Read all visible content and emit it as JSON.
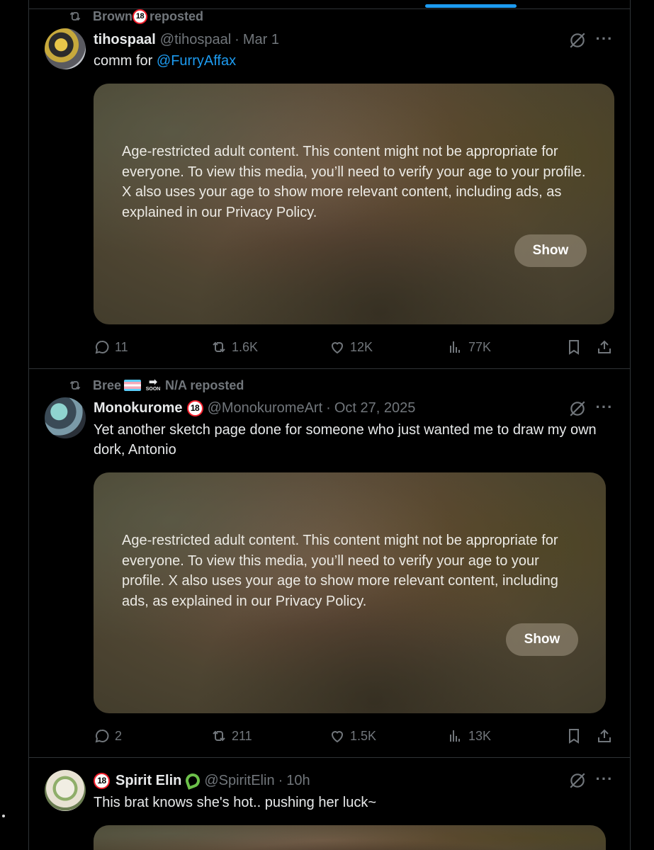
{
  "posts": [
    {
      "repost_by": "Brown",
      "repost_suffix": "reposted",
      "name": "tihospaal",
      "handle": "@tihospaal",
      "separator": "·",
      "time": "Mar 1",
      "text_prefix": "comm for ",
      "mention": "@FurryAffax",
      "warning": "Age-restricted adult content. This content might not be appropriate for everyone. To view this media, you’ll need to verify your age to your profile. X also uses your age to show more relevant content, including ads, as explained in our Privacy Policy.",
      "show_label": "Show",
      "replies": "11",
      "reposts": "1.6K",
      "likes": "12K",
      "views": "77K"
    },
    {
      "repost_by": "Bree",
      "repost_soon": "SOON",
      "repost_by_tail": "N/A reposted",
      "name": "Monokurome",
      "handle": "@MonokuromeArt",
      "separator": "·",
      "time": "Oct 27, 2025",
      "text": "Yet another sketch page done for someone who just wanted me to draw my own dork, Antonio",
      "warning": "Age-restricted adult content. This content might not be appropriate for everyone. To view this media, you’ll need to verify your age to your profile. X also uses your age to show more relevant content, including ads, as explained in our Privacy Policy.",
      "show_label": "Show",
      "replies": "2",
      "reposts": "211",
      "likes": "1.5K",
      "views": "13K"
    },
    {
      "name": "Spirit Elin",
      "handle": "@SpiritElin",
      "separator": "·",
      "time": "10h",
      "text": "This brat knows she's hot.. pushing her luck~"
    }
  ],
  "badge_text": "18",
  "colors": {
    "background": "#000000",
    "divider": "#2f3336",
    "muted": "#71767b",
    "accent": "#1d9bf0",
    "age_badge": "#f4212e"
  },
  "icons": [
    "repost-icon",
    "grok-icon",
    "more-icon",
    "reply-icon",
    "like-icon",
    "views-icon",
    "bookmark-icon",
    "share-icon"
  ]
}
